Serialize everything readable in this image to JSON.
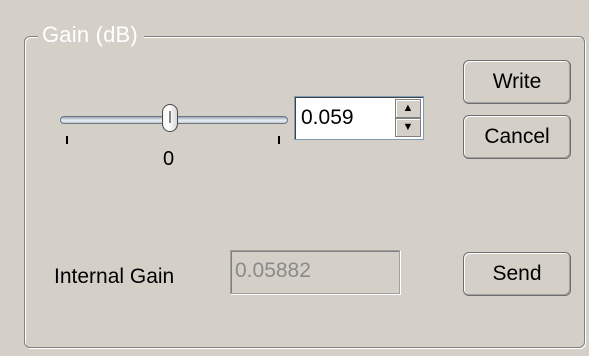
{
  "group": {
    "title": "Gain (dB)"
  },
  "slider": {
    "value": 0,
    "label": "0"
  },
  "spinbox": {
    "value": "0.059",
    "up_icon": "spin-up-arrow",
    "down_icon": "spin-down-arrow"
  },
  "buttons": {
    "write": "Write",
    "cancel": "Cancel",
    "send": "Send"
  },
  "internal_gain": {
    "label": "Internal Gain",
    "value": "0.05882"
  }
}
